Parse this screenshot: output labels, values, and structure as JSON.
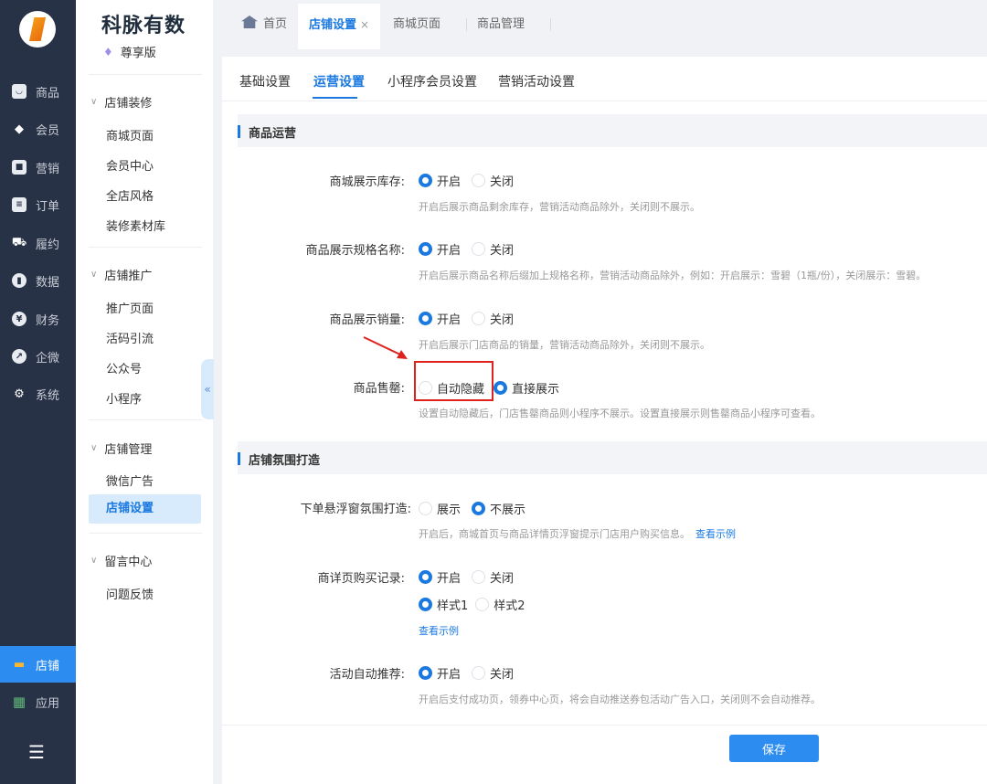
{
  "rail": {
    "items": [
      {
        "label": "商品",
        "icon": "product-icon"
      },
      {
        "label": "会员",
        "icon": "member-icon"
      },
      {
        "label": "营销",
        "icon": "marketing-icon"
      },
      {
        "label": "订单",
        "icon": "order-icon"
      },
      {
        "label": "履约",
        "icon": "delivery-icon"
      },
      {
        "label": "数据",
        "icon": "data-icon"
      },
      {
        "label": "财务",
        "icon": "finance-icon"
      },
      {
        "label": "企微",
        "icon": "wecom-icon"
      },
      {
        "label": "系统",
        "icon": "settings-icon"
      }
    ],
    "store": "店铺",
    "apps": "应用"
  },
  "sidebar": {
    "brand": "科脉有数",
    "edition": "尊享版",
    "groups": [
      {
        "title": "店铺装修",
        "items": [
          "商城页面",
          "会员中心",
          "全店风格",
          "装修素材库"
        ]
      },
      {
        "title": "店铺推广",
        "items": [
          "推广页面",
          "活码引流",
          "公众号",
          "小程序"
        ]
      },
      {
        "title": "店铺管理",
        "items": [
          "微信广告",
          "店铺设置"
        ]
      },
      {
        "title": "留言中心",
        "items": [
          "问题反馈"
        ]
      }
    ]
  },
  "tabs": {
    "home": "首页",
    "active": "店铺设置",
    "close": "×",
    "t3": "商城页面",
    "t4": "商品管理"
  },
  "subtabs": [
    "基础设置",
    "运营设置",
    "小程序会员设置",
    "营销活动设置"
  ],
  "sections": {
    "goods": "商品运营",
    "atmosphere": "店铺氛围打造"
  },
  "settings": {
    "stock": {
      "label": "商城展示库存:",
      "on": "开启",
      "off": "关闭",
      "help": "开启后展示商品剩余库存，营销活动商品除外，关闭则不展示。"
    },
    "spec": {
      "label": "商品展示规格名称:",
      "on": "开启",
      "off": "关闭",
      "help": "开启后展示商品名称后缀加上规格名称，营销活动商品除外，例如：开启展示：雪碧（1瓶/份），关闭展示：雪碧。"
    },
    "sales": {
      "label": "商品展示销量:",
      "on": "开启",
      "off": "关闭",
      "help": "开启后展示门店商品的销量，营销活动商品除外，关闭则不展示。"
    },
    "soldout": {
      "label": "商品售罄:",
      "hide": "自动隐藏",
      "show": "直接展示",
      "help": "设置自动隐藏后，门店售罄商品则小程序不展示。设置直接展示则售罄商品小程序可查看。"
    },
    "float": {
      "label": "下单悬浮窗氛围打造:",
      "show": "展示",
      "noshow": "不展示",
      "help": "开启后，商城首页与商品详情页浮窗提示门店用户购买信息。",
      "link": "查看示例"
    },
    "buyrec": {
      "label": "商详页购买记录:",
      "on": "开启",
      "off": "关闭",
      "style1": "样式1",
      "style2": "样式2",
      "link": "查看示例"
    },
    "recommend": {
      "label": "活动自动推荐:",
      "on": "开启",
      "off": "关闭",
      "help": "开启后支付成功页，领券中心页，将会自动推送券包活动广告入口，关闭则不会自动推荐。"
    }
  },
  "save": "保存",
  "colors": {
    "accent": "#1a79e0",
    "rail": "#283246",
    "highlight": "#e0221e"
  }
}
